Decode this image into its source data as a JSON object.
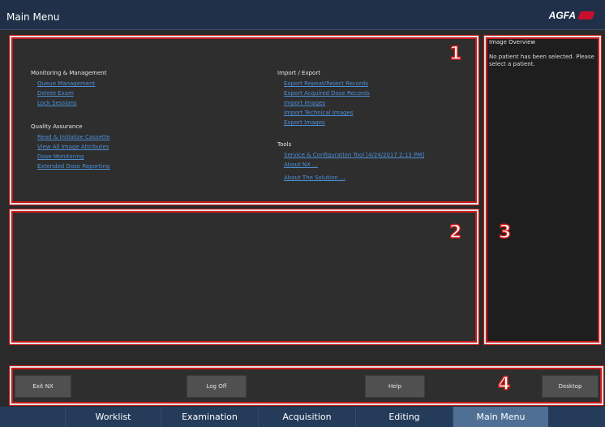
{
  "window": {
    "title": "Main Menu",
    "brand": "AGFA"
  },
  "panel1": {
    "badge": "1",
    "left": {
      "monitoring": {
        "title": "Monitoring & Management",
        "links": [
          "Queue Management",
          "Delete Exam",
          "Lock Sessions"
        ]
      },
      "qa": {
        "title": "Quality Assurance",
        "links": [
          "Read & Initialize Cassette",
          "View All Image Attributes",
          "Dose Monitoring",
          "Extended Dose Reporting"
        ]
      }
    },
    "right": {
      "import_export": {
        "title": "Import / Export",
        "links": [
          "Export Repeat/Reject Records",
          "Export Acquired Dose Records",
          "Import Images",
          "Import Technical Images",
          "Export Images"
        ]
      },
      "tools": {
        "title": "Tools",
        "links": [
          "Service & Configuration Tool  [4/24/2017 2:13 PM]",
          "About NX ...",
          "About The Solution ..."
        ]
      }
    }
  },
  "panel2": {
    "badge": "2"
  },
  "panel3": {
    "badge": "3",
    "title": "Image Overview",
    "message": "No patient has been selected. Please select a patient."
  },
  "panel4": {
    "badge": "4",
    "buttons": {
      "exit": "Exit NX",
      "logoff": "Log Off",
      "help": "Help",
      "desktop": "Desktop"
    }
  },
  "tabs": [
    "Worklist",
    "Examination",
    "Acquisition",
    "Editing",
    "Main Menu"
  ],
  "colors": {
    "accent": "#4f6f95",
    "link": "#4d8fd6",
    "frame": "#cc1a1a",
    "brand": "#c8102e"
  }
}
